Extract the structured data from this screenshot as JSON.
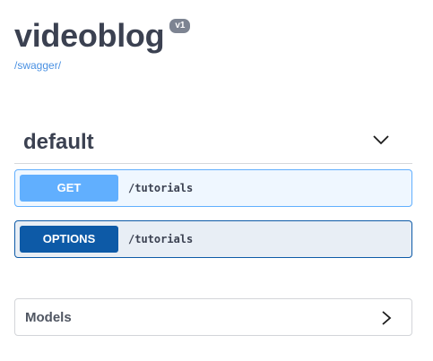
{
  "header": {
    "title": "videoblog",
    "version": "v1",
    "link": "/swagger/"
  },
  "section": {
    "title": "default",
    "expanded": true,
    "toggle_icon": "chevron-down-icon"
  },
  "operations": [
    {
      "method": "GET",
      "path": "/tutorials",
      "color": "#61affe"
    },
    {
      "method": "OPTIONS",
      "path": "/tutorials",
      "color": "#0d5aa7"
    }
  ],
  "models": {
    "title": "Models",
    "expanded": false,
    "toggle_icon": "chevron-right-icon"
  },
  "colors": {
    "title_text": "#3b4151",
    "link": "#4990e2",
    "badge": "#7d8492"
  }
}
